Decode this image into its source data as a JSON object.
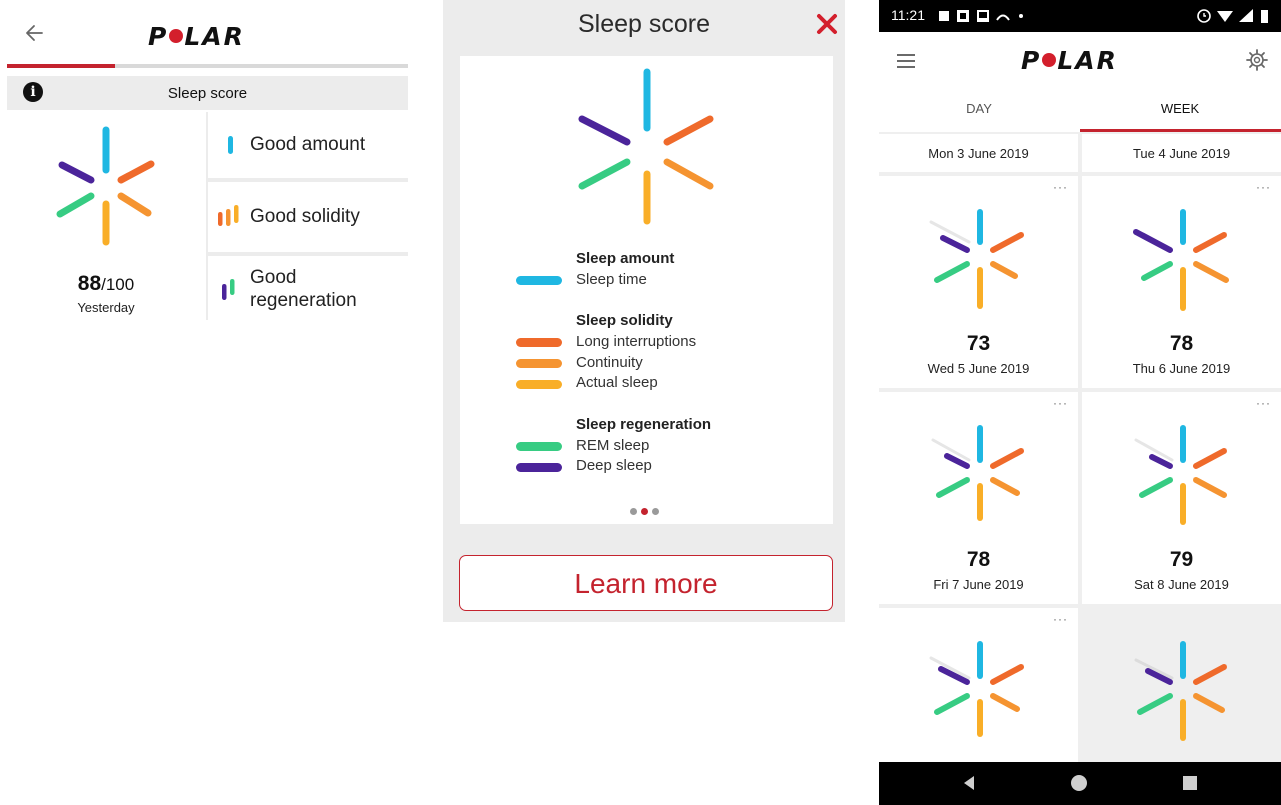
{
  "brand": {
    "logo_text": "POLAR"
  },
  "colors": {
    "accent": "#c4232e",
    "cyan": "#1fb7e2",
    "orange_dark": "#ef6a2b",
    "orange": "#f59431",
    "yellow": "#f9ae28",
    "green": "#37cc83",
    "purple": "#4b249a"
  },
  "detail_screen": {
    "back_icon": "arrow-left-icon",
    "header_title": "Sleep score",
    "info_icon": "info-icon",
    "score_value": "88",
    "score_denominator": "/100",
    "day_label": "Yesterday",
    "summary_rows": [
      {
        "label": "Good amount",
        "icon": "amount-bars-icon"
      },
      {
        "label": "Good solidity",
        "icon": "solidity-bars-icon"
      },
      {
        "label_line1": "Good",
        "label_line2": "regeneration",
        "icon": "regeneration-bars-icon"
      }
    ]
  },
  "legend_dialog": {
    "title": "Sleep score",
    "close_icon": "close-icon",
    "groups": [
      {
        "heading": "Sleep amount",
        "items": [
          {
            "label": "Sleep time",
            "color": "#1fb7e2"
          }
        ]
      },
      {
        "heading": "Sleep solidity",
        "items": [
          {
            "label": "Long interruptions",
            "color": "#ef6a2b"
          },
          {
            "label": "Continuity",
            "color": "#f59431"
          },
          {
            "label": "Actual sleep",
            "color": "#f9ae28"
          }
        ]
      },
      {
        "heading": "Sleep regeneration",
        "items": [
          {
            "label": "REM sleep",
            "color": "#37cc83"
          },
          {
            "label": "Deep sleep",
            "color": "#4b249a"
          }
        ]
      }
    ],
    "learn_more_label": "Learn more"
  },
  "week_screen": {
    "status_time": "11:21",
    "tabs": [
      {
        "label": "DAY"
      },
      {
        "label": "WEEK"
      }
    ],
    "partial_row": [
      {
        "date": "Mon 3 June 2019"
      },
      {
        "date": "Tue 4 June 2019"
      }
    ],
    "days": [
      {
        "score": "73",
        "date": "Wed 5 June 2019"
      },
      {
        "score": "78",
        "date": "Thu 6 June 2019"
      },
      {
        "score": "78",
        "date": "Fri 7 June 2019"
      },
      {
        "score": "79",
        "date": "Sat 8 June 2019"
      }
    ],
    "more_label": "···",
    "nav": [
      "back-triangle-icon",
      "home-circle-icon",
      "recents-square-icon"
    ]
  }
}
